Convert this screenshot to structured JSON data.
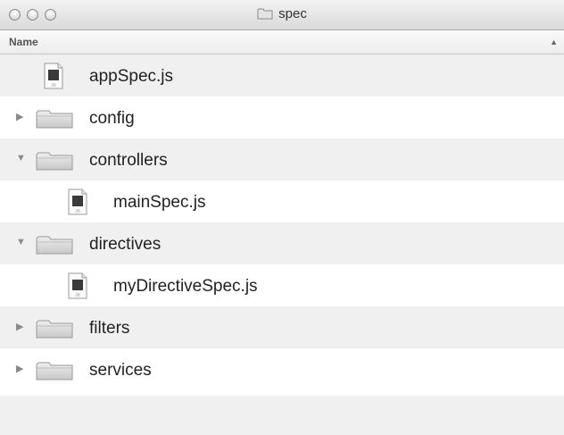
{
  "window": {
    "title": "spec",
    "folder_icon": "folder-icon"
  },
  "header": {
    "name_label": "Name",
    "sort_arrow": "▲"
  },
  "rows": [
    {
      "kind": "file",
      "name": "appSpec.js",
      "depth": 0,
      "icon": "js-file-icon",
      "file_badge": "JS"
    },
    {
      "kind": "folder",
      "name": "config",
      "depth": 0,
      "expanded": false,
      "disclosure": "▶",
      "icon": "folder-icon"
    },
    {
      "kind": "folder",
      "name": "controllers",
      "depth": 0,
      "expanded": true,
      "disclosure": "▼",
      "icon": "folder-icon"
    },
    {
      "kind": "file",
      "name": "mainSpec.js",
      "depth": 1,
      "icon": "js-file-icon",
      "file_badge": "JS"
    },
    {
      "kind": "folder",
      "name": "directives",
      "depth": 0,
      "expanded": true,
      "disclosure": "▼",
      "icon": "folder-icon"
    },
    {
      "kind": "file",
      "name": "myDirectiveSpec.js",
      "depth": 1,
      "icon": "js-file-icon",
      "file_badge": "JS"
    },
    {
      "kind": "folder",
      "name": "filters",
      "depth": 0,
      "expanded": false,
      "disclosure": "▶",
      "icon": "folder-icon"
    },
    {
      "kind": "folder",
      "name": "services",
      "depth": 0,
      "expanded": false,
      "disclosure": "▶",
      "icon": "folder-icon"
    }
  ]
}
